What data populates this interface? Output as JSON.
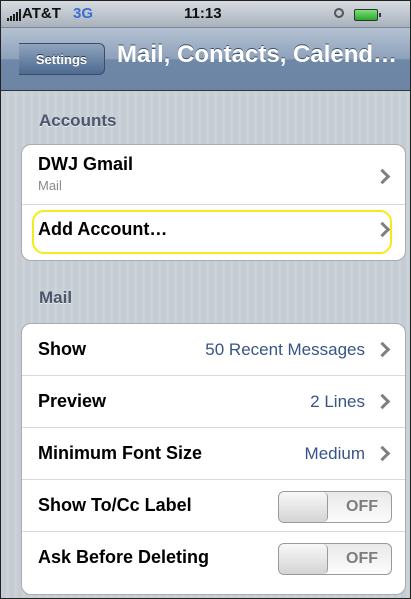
{
  "status": {
    "carrier": "AT&T",
    "network": "3G",
    "time": "11:13"
  },
  "nav": {
    "back_label": "Settings",
    "title": "Mail, Contacts, Calend…"
  },
  "accounts": {
    "header": "Accounts",
    "items": [
      {
        "label": "DWJ Gmail",
        "sub": "Mail"
      }
    ],
    "add_label": "Add Account…"
  },
  "mail": {
    "header": "Mail",
    "rows": [
      {
        "label": "Show",
        "value": "50 Recent Messages"
      },
      {
        "label": "Preview",
        "value": "2 Lines"
      },
      {
        "label": "Minimum Font Size",
        "value": "Medium"
      },
      {
        "label": "Show To/Cc Label",
        "toggle": "OFF"
      },
      {
        "label": "Ask Before Deleting",
        "toggle": "OFF"
      }
    ]
  }
}
